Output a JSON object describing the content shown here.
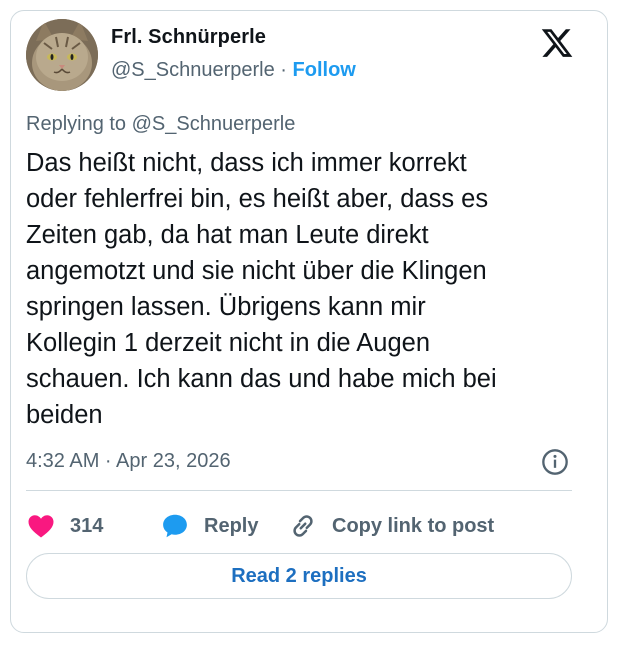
{
  "author": {
    "name": "Frl. Schnürperle",
    "handle": "@S_Schnuerperle",
    "separator": "·",
    "follow_label": "Follow",
    "avatar_icon": "cat-avatar"
  },
  "platform_icon": "x-logo-icon",
  "post": {
    "replying_to": "Replying to @S_Schnuerperle",
    "lines": [
      "Das heißt nicht, dass ich immer korrekt",
      "oder fehlerfrei bin, es heißt aber, dass es",
      "Zeiten gab, da hat man Leute direkt",
      "angemotzt und sie nicht über die Klingen",
      "springen lassen. Übrigens kann mir",
      "Kollegin 1 derzeit nicht in die Augen",
      "schauen. Ich kann das und habe mich bei",
      "beiden"
    ],
    "timestamp": "4:32 AM · Apr 23, 2026"
  },
  "actions": {
    "like_count": "314",
    "reply_label": "Reply",
    "copy_link_label": "Copy link to post"
  },
  "read_replies_label": "Read 2 replies",
  "colors": {
    "accent": "#1d9bf0",
    "heart": "#f91880",
    "text": "#0f1419",
    "muted": "#536471",
    "border": "#cfd9de"
  }
}
